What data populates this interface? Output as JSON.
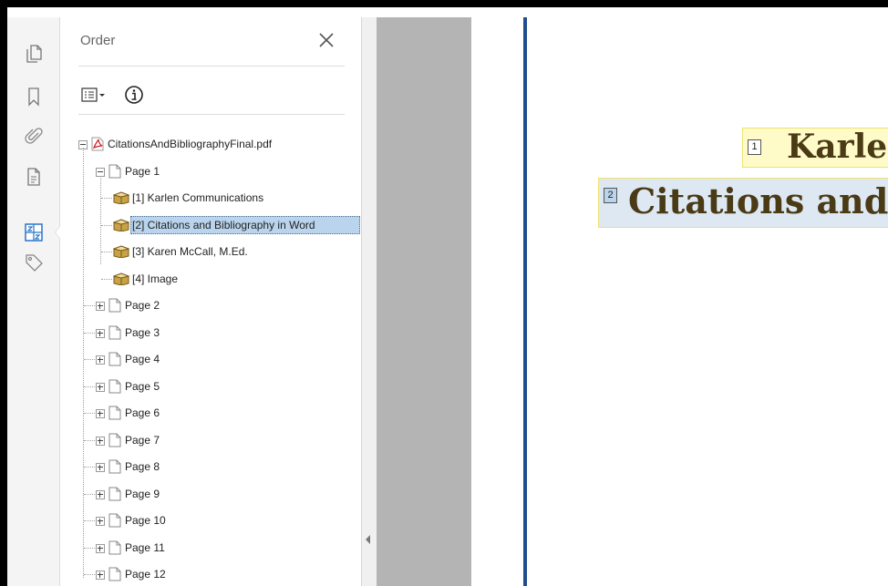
{
  "panel": {
    "title": "Order"
  },
  "tree": {
    "root": "CitationsAndBibliographyFinal.pdf",
    "page1": "Page 1",
    "page1_items": [
      "[1] Karlen Communications",
      "[2] Citations and Bibliography in Word",
      "[3] Karen McCall, M.Ed.",
      "[4] Image"
    ],
    "pages": [
      "Page 2",
      "Page 3",
      "Page 4",
      "Page 5",
      "Page 6",
      "Page 7",
      "Page 8",
      "Page 9",
      "Page 10",
      "Page 11",
      "Page 12"
    ]
  },
  "document": {
    "tag1_num": "1",
    "tag1_text": "Karlen Communications",
    "tag2_num": "2",
    "tag2_text": "Citations and Bibliography in Word"
  },
  "icons": {
    "rail": [
      "pages-icon",
      "bookmark-icon",
      "attachment-icon",
      "document-properties-icon",
      "order-icon",
      "tags-icon"
    ]
  },
  "colors": {
    "selection": "#b9d4ec",
    "tag_highlight": "#fffbc8",
    "page_border": "#1f4f8e",
    "doc_text": "#4a3a16"
  }
}
